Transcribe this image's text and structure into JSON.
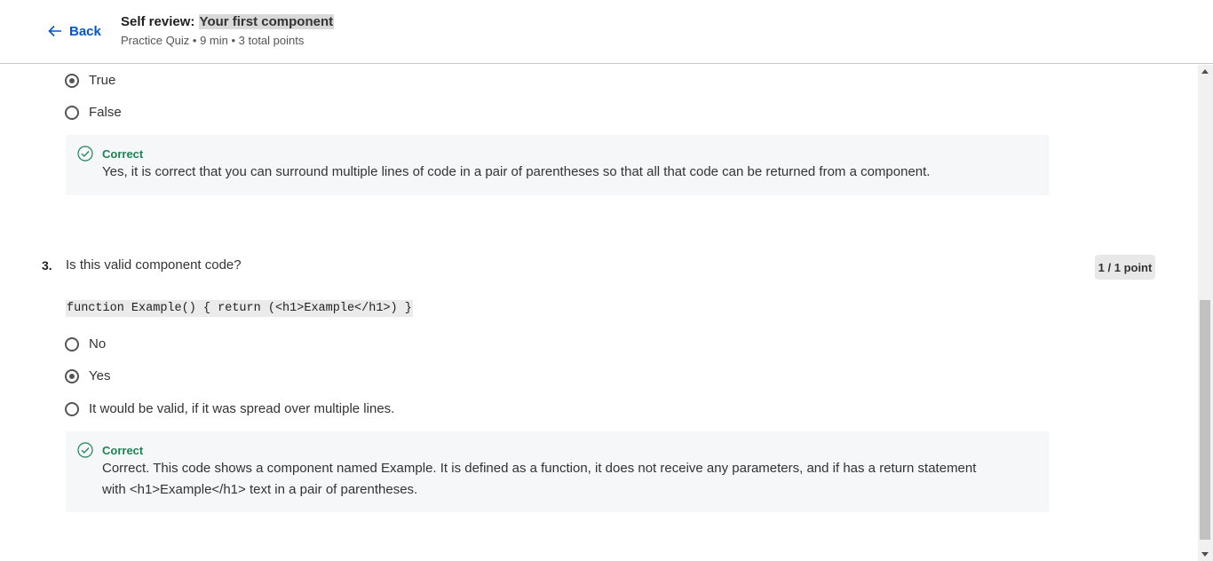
{
  "header": {
    "back_label": "Back",
    "title_prefix": "Self review: ",
    "title_highlight": "Your first component",
    "subtitle": "Practice Quiz • 9 min • 3 total points"
  },
  "q2": {
    "options": [
      {
        "label": "True",
        "checked": true
      },
      {
        "label": "False",
        "checked": false
      }
    ],
    "feedback": {
      "title": "Correct",
      "text": "Yes, it is correct that you can surround multiple lines of code in a pair of parentheses so that all that code can be returned from a component."
    }
  },
  "q3": {
    "number": "3.",
    "question": "Is this valid component code?",
    "points": "1 / 1 point",
    "code": "function Example() { return (<h1>Example</h1>) }",
    "options": [
      {
        "label": "No",
        "checked": false
      },
      {
        "label": "Yes",
        "checked": true
      },
      {
        "label": "It would be valid, if it was spread over multiple lines.",
        "checked": false
      }
    ],
    "feedback": {
      "title": "Correct",
      "text": "Correct. This code shows a component named Example. It is defined as a function, it does not receive any parameters, and if has a return statement with <h1>Example</h1> text in a pair of parentheses."
    }
  }
}
